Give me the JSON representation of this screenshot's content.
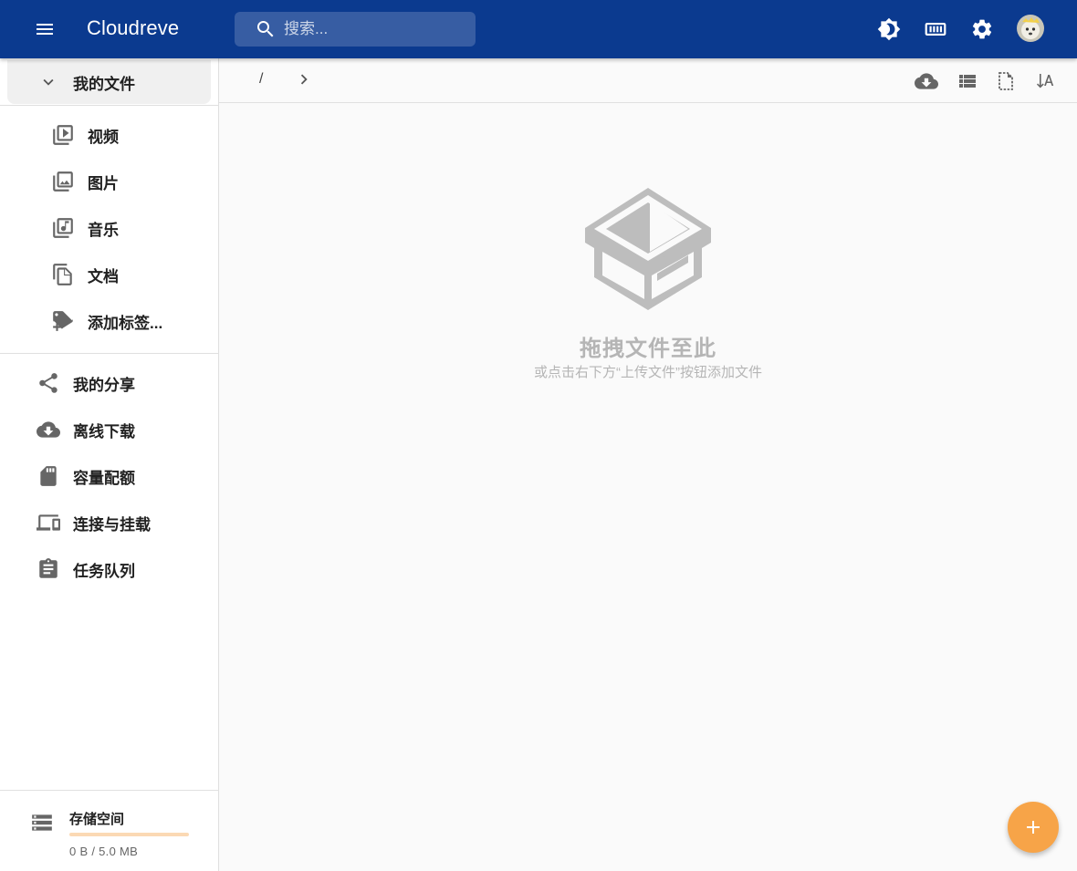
{
  "app": {
    "title": "Cloudreve"
  },
  "search": {
    "placeholder": "搜索..."
  },
  "topbar": {
    "icons": [
      "theme-toggle-icon",
      "memory-icon",
      "settings-icon"
    ]
  },
  "sidebar": {
    "my_files": "我的文件",
    "sub_items": [
      {
        "label": "视频",
        "icon": "video-library-icon"
      },
      {
        "label": "图片",
        "icon": "photo-library-icon"
      },
      {
        "label": "音乐",
        "icon": "library-music-icon"
      },
      {
        "label": "文档",
        "icon": "file-copy-icon"
      },
      {
        "label": "添加标签...",
        "icon": "add-tag-icon"
      }
    ],
    "items": [
      {
        "label": "我的分享",
        "icon": "share-icon"
      },
      {
        "label": "离线下载",
        "icon": "cloud-download-icon"
      },
      {
        "label": "容量配额",
        "icon": "sd-card-icon"
      },
      {
        "label": "连接与挂载",
        "icon": "devices-icon"
      },
      {
        "label": "任务队列",
        "icon": "assignment-icon"
      }
    ]
  },
  "storage": {
    "title": "存储空间",
    "size_text": "0 B / 5.0 MB",
    "used_fraction": 0
  },
  "breadcrumb": {
    "root": "/"
  },
  "empty_state": {
    "title": "拖拽文件至此",
    "subtitle": "或点击右下方“上传文件”按钮添加文件"
  },
  "colors": {
    "appbar": "#0b3a8f",
    "fab": "#f7a448",
    "storage_bar": "#fbd9b4"
  }
}
